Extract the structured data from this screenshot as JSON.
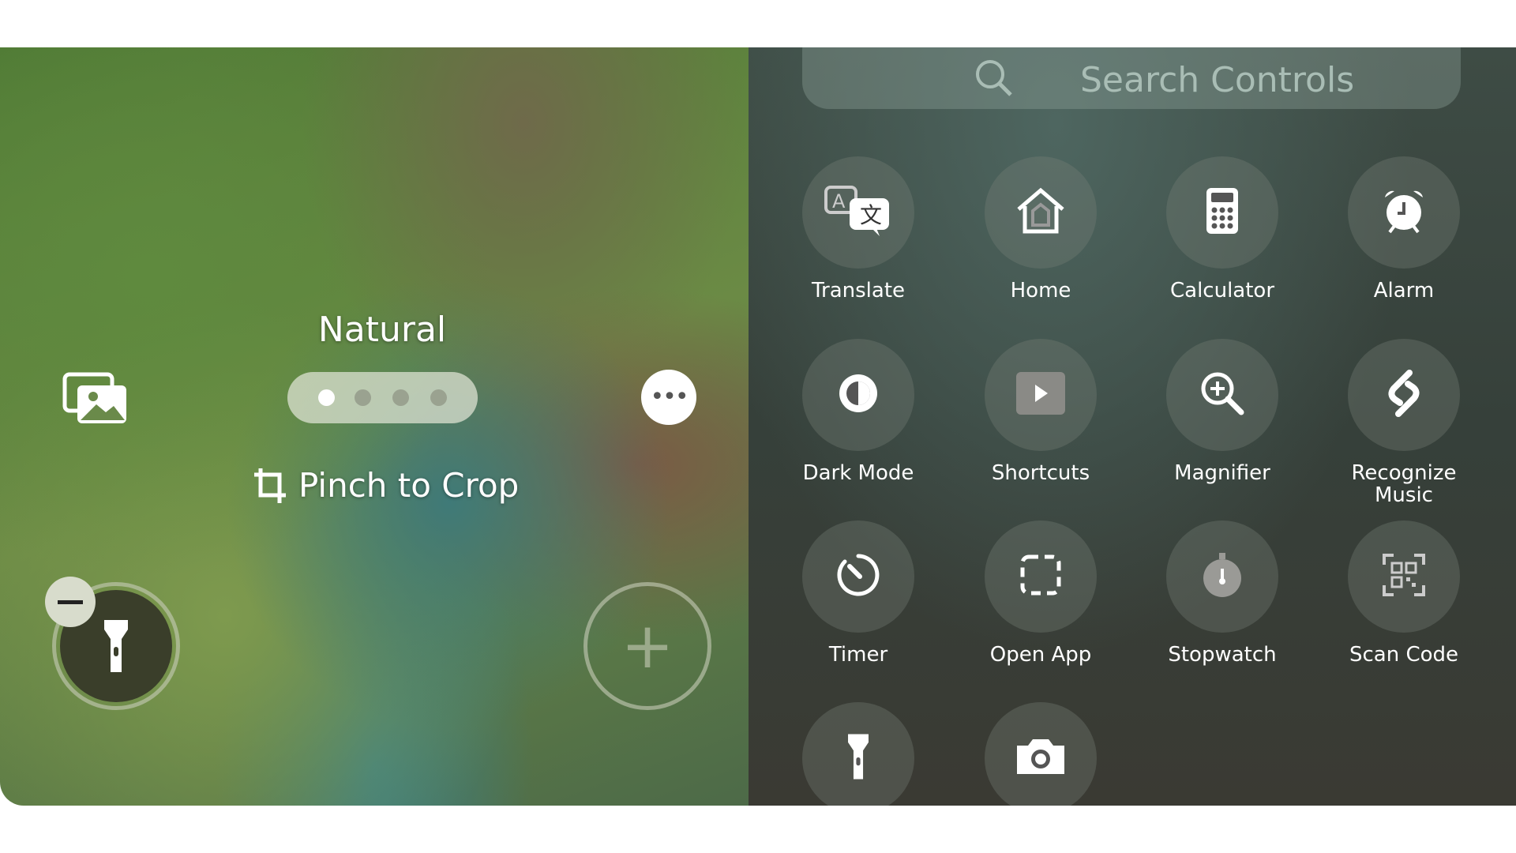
{
  "left": {
    "filter_name": "Natural",
    "filter_dots": 4,
    "active_dot": 0,
    "hint": "Pinch to Crop"
  },
  "right": {
    "search_placeholder": "Search Controls",
    "controls": [
      {
        "label": "Translate",
        "icon": "translate-icon"
      },
      {
        "label": "Home",
        "icon": "home-icon"
      },
      {
        "label": "Calculator",
        "icon": "calculator-icon"
      },
      {
        "label": "Alarm",
        "icon": "alarm-icon"
      },
      {
        "label": "Dark Mode",
        "icon": "dark-mode-icon"
      },
      {
        "label": "Shortcuts",
        "icon": "shortcuts-icon"
      },
      {
        "label": "Magnifier",
        "icon": "magnifier-icon"
      },
      {
        "label": "Recognize Music",
        "icon": "shazam-icon"
      },
      {
        "label": "Timer",
        "icon": "timer-icon"
      },
      {
        "label": "Open App",
        "icon": "open-app-icon"
      },
      {
        "label": "Stopwatch",
        "icon": "stopwatch-icon"
      },
      {
        "label": "Scan Code",
        "icon": "qr-code-icon"
      },
      {
        "label": "",
        "icon": "flashlight-icon"
      },
      {
        "label": "",
        "icon": "camera-icon"
      }
    ]
  }
}
